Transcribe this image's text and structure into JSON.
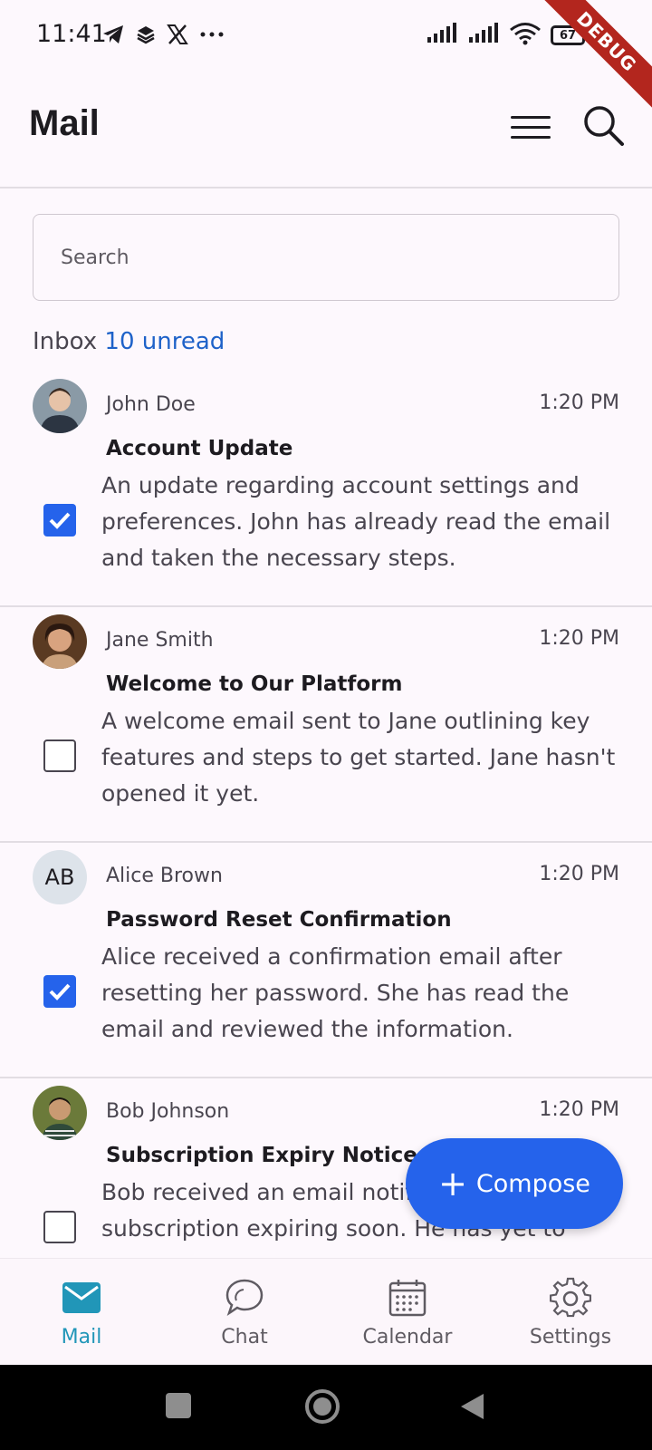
{
  "status_bar": {
    "time": "11:41",
    "left_icons": [
      "telegram-icon",
      "layers-icon",
      "x-icon",
      "more-dots-icon"
    ],
    "battery": "67",
    "debug_label": "DEBUG"
  },
  "app_bar": {
    "title": "Mail"
  },
  "search": {
    "placeholder": "Search"
  },
  "inbox": {
    "label": "Inbox",
    "unread": "10 unread"
  },
  "emails": [
    {
      "sender": "John Doe",
      "time": "1:20 PM",
      "subject": "Account Update",
      "preview": "An update regarding account settings and preferences. John has already read the email and taken the necessary steps.",
      "checked": true,
      "avatar_initials": ""
    },
    {
      "sender": "Jane Smith",
      "time": "1:20 PM",
      "subject": "Welcome to Our Platform",
      "preview": "A welcome email sent to Jane outlining key features and steps to get started. Jane hasn't opened it yet.",
      "checked": false,
      "avatar_initials": ""
    },
    {
      "sender": "Alice Brown",
      "time": "1:20 PM",
      "subject": "Password Reset Confirmation",
      "preview": "Alice received a confirmation email after resetting her password. She has read the email and reviewed the information.",
      "checked": true,
      "avatar_initials": "AB"
    },
    {
      "sender": "Bob Johnson",
      "time": "1:20 PM",
      "subject": "Subscription Expiry Notice",
      "preview": "Bob received an email notification about his subscription expiring soon. He has yet to",
      "checked": false,
      "avatar_initials": ""
    }
  ],
  "fab": {
    "label": "Compose"
  },
  "bottom_nav": {
    "items": [
      {
        "label": "Mail",
        "icon": "mail-icon",
        "active": true
      },
      {
        "label": "Chat",
        "icon": "chat-icon",
        "active": false
      },
      {
        "label": "Calendar",
        "icon": "calendar-icon",
        "active": false
      },
      {
        "label": "Settings",
        "icon": "settings-icon",
        "active": false
      }
    ]
  },
  "colors": {
    "accent": "#2563eb",
    "active_nav": "#2196b8",
    "unread": "#1e62c9",
    "background": "#fdf8fd"
  }
}
